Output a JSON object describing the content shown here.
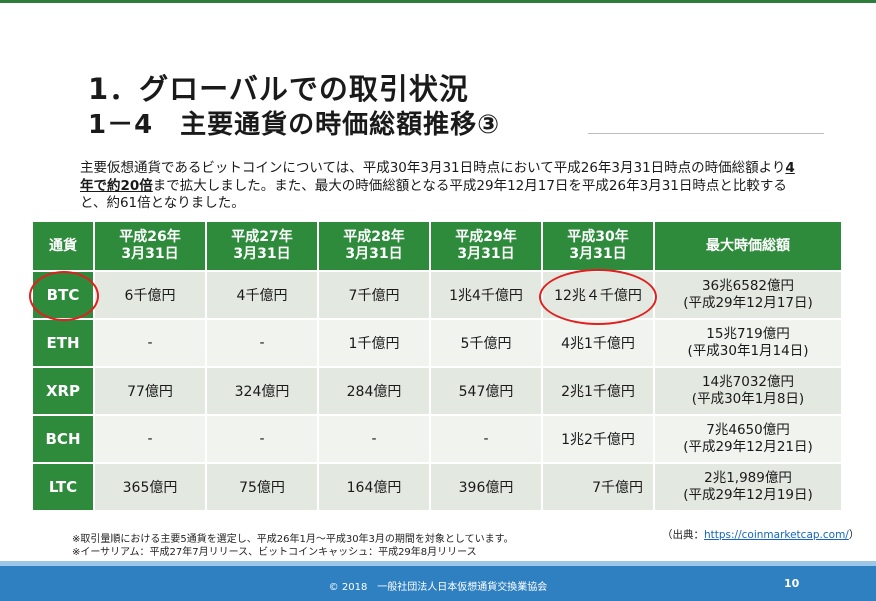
{
  "title": "1．グローバルでの取引状況",
  "subtitle": "1－4　主要通貨の時価総額推移③",
  "intro": {
    "part1": "主要仮想通貨であるビットコインについては、平成30年3月31日時点において平成26年3月31日時点の時価総額より",
    "emphasis": "4年で約20倍",
    "part2": "まで拡大しました。また、最大の時価総額となる平成29年12月17日を平成26年3月31日時点と比較すると、約61倍となりました。"
  },
  "table": {
    "headers": [
      {
        "line1": "通貨",
        "line2": ""
      },
      {
        "line1": "平成26年",
        "line2": "3月31日"
      },
      {
        "line1": "平成27年",
        "line2": "3月31日"
      },
      {
        "line1": "平成28年",
        "line2": "3月31日"
      },
      {
        "line1": "平成29年",
        "line2": "3月31日"
      },
      {
        "line1": "平成30年",
        "line2": "3月31日"
      },
      {
        "line1": "最大時価総額",
        "line2": ""
      }
    ],
    "rows": [
      {
        "coin": "BTC",
        "cells": [
          "6千億円",
          "4千億円",
          "7千億円",
          "1兆4千億円",
          "12兆４千億円"
        ],
        "max1": "36兆6582億円",
        "max2": "(平成29年12月17日)"
      },
      {
        "coin": "ETH",
        "cells": [
          "-",
          "-",
          "1千億円",
          "5千億円",
          "4兆1千億円"
        ],
        "max1": "15兆719億円",
        "max2": "(平成30年1月14日)"
      },
      {
        "coin": "XRP",
        "cells": [
          "77億円",
          "324億円",
          "284億円",
          "547億円",
          "2兆1千億円"
        ],
        "max1": "14兆7032億円",
        "max2": "(平成30年1月8日)"
      },
      {
        "coin": "BCH",
        "cells": [
          "-",
          "-",
          "-",
          "-",
          "1兆2千億円"
        ],
        "max1": "7兆4650億円",
        "max2": "(平成29年12月21日)"
      },
      {
        "coin": "LTC",
        "cells": [
          "365億円",
          "75億円",
          "164億円",
          "396億円",
          "7千億円"
        ],
        "max1": "2兆1,989億円",
        "max2": "(平成29年12月19日)"
      }
    ]
  },
  "notes": [
    "※取引量順における主要5通貨を選定し、平成26年1月～平成30年3月の期間を対象としています。",
    "※イーサリアム：平成27年7月リリース、ビットコインキャッシュ：平成29年8月リリース"
  ],
  "source": {
    "prefix": "（出典：",
    "link": "https://coinmarketcap.com/",
    "suffix": "）"
  },
  "footer": {
    "copyright": "© 2018　一般社団法人日本仮想通貨交換業協会",
    "page": "10"
  },
  "colors": {
    "header_green": "#2e8b3c",
    "highlight_red": "#e02020",
    "footer_blue": "#2f80c0"
  }
}
